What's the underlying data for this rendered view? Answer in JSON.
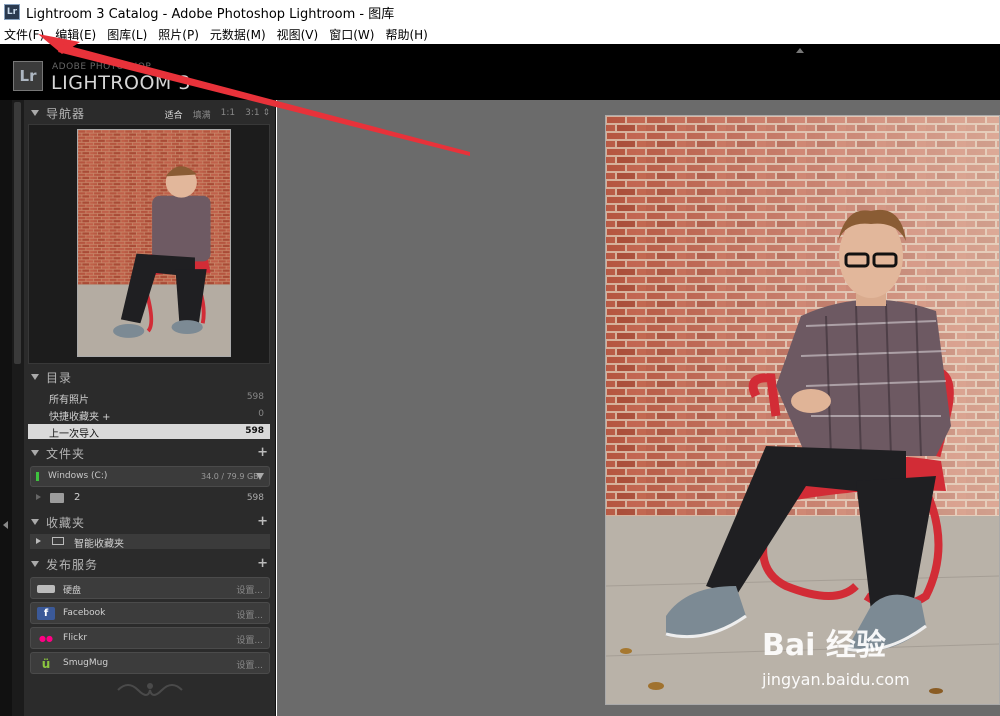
{
  "window": {
    "icon_text": "Lr",
    "title": "Lightroom 3 Catalog - Adobe Photoshop Lightroom - 图库"
  },
  "menu": [
    "文件(F)",
    "编辑(E)",
    "图库(L)",
    "照片(P)",
    "元数据(M)",
    "视图(V)",
    "窗口(W)",
    "帮助(H)"
  ],
  "header": {
    "badge": "Lr",
    "brand_small": "ADOBE PHOTOSHOP",
    "brand_big": "LIGHTROOM 3"
  },
  "navigator": {
    "title": "导航器",
    "options": [
      "适合",
      "填满",
      "1:1",
      "3:1 ⇕"
    ],
    "selected_option": "适合"
  },
  "catalog": {
    "title": "目录",
    "rows": [
      {
        "label": "所有照片",
        "count": "598"
      },
      {
        "label": "快捷收藏夹 +",
        "count": "0"
      },
      {
        "label": "上一次导入",
        "count": "598"
      }
    ]
  },
  "folders": {
    "title": "文件夹",
    "volume_name": "Windows (C:)",
    "volume_size": "34.0 / 79.9 GB",
    "folder_name": "2",
    "folder_count": "598"
  },
  "collections": {
    "title": "收藏夹",
    "smart_collection": "智能收藏夹"
  },
  "publish": {
    "title": "发布服务",
    "services": [
      {
        "name": "硬盘",
        "settings": "设置...",
        "icon": "hard-drive-icon",
        "icon_text": "",
        "icon_bg": "#bbbbbb",
        "icon_fg": "#333333"
      },
      {
        "name": "Facebook",
        "settings": "设置...",
        "icon": "facebook-icon",
        "icon_text": "f",
        "icon_bg": "#3b5998",
        "icon_fg": "#ffffff"
      },
      {
        "name": "Flickr",
        "settings": "设置...",
        "icon": "flickr-icon",
        "icon_text": "●●",
        "icon_bg": "#3c3c3c",
        "icon_fg": "#ff0084"
      },
      {
        "name": "SmugMug",
        "settings": "设置...",
        "icon": "smugmug-icon",
        "icon_text": "ü",
        "icon_bg": "#3c3c3c",
        "icon_fg": "#8cc63f"
      }
    ]
  },
  "watermark": {
    "logo": "Bai 经验",
    "url": "jingyan.baidu.com"
  },
  "colors": {
    "annotation_arrow": "#e8323a",
    "panel_bg": "#2b2b2b",
    "main_bg": "#6b6b6b"
  }
}
